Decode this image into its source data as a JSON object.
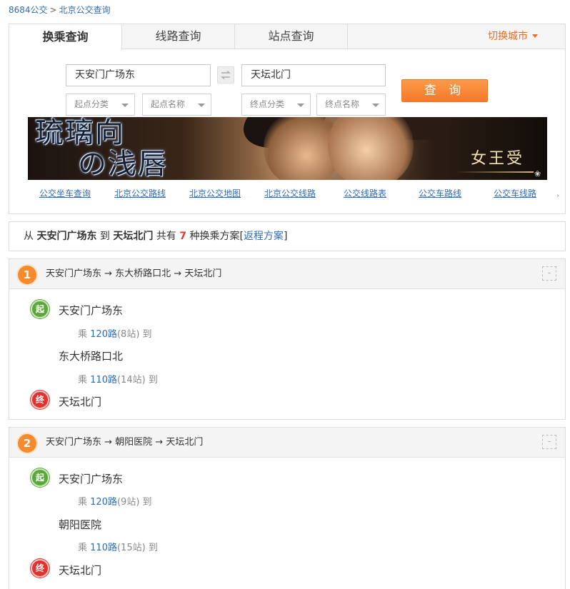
{
  "breadcrumb": {
    "home": "8684公交",
    "sep": ">",
    "current": "北京公交查询"
  },
  "tabs": [
    {
      "label": "换乘查询"
    },
    {
      "label": "线路查询"
    },
    {
      "label": "站点查询"
    }
  ],
  "switch_city": "切换城市",
  "search": {
    "from_value": "天安门广场东",
    "to_value": "天坛北门",
    "start_category": "起点分类",
    "start_name": "起点名称",
    "end_category": "终点分类",
    "end_name": "终点名称",
    "submit_label": "查 询"
  },
  "banner": {
    "title_line1": "琉璃向",
    "title_line2": "の浅唇",
    "subtitle": "女王受"
  },
  "quick_links": [
    "公交坐车查询",
    "北京公交路线",
    "北京公交地图",
    "北京公交线路",
    "公交线路表",
    "公交车路线",
    "公交车线路"
  ],
  "summary": {
    "from_prefix": "从",
    "from": "天安门广场东",
    "to_prefix": "到",
    "to": "天坛北门",
    "total_prefix": "共有",
    "count": "7",
    "total_suffix": "种换乘方案",
    "return_open": "[",
    "return_link": "返程方案",
    "return_close": "]"
  },
  "plans": [
    {
      "num": "1",
      "route": "天安门广场东 → 东大桥路口北 → 天坛北门",
      "toggle": "-",
      "start_badge": "起",
      "start": "天安门广场东",
      "leg1": {
        "ride": "乘",
        "line": "120路",
        "stops": "(8站)",
        "arrive": "到"
      },
      "transfer": "东大桥路口北",
      "leg2": {
        "ride": "乘",
        "line": "110路",
        "stops": "(14站)",
        "arrive": "到"
      },
      "end_badge": "终",
      "end": "天坛北门"
    },
    {
      "num": "2",
      "route": "天安门广场东 → 朝阳医院 → 天坛北门",
      "toggle": "-",
      "start_badge": "起",
      "start": "天安门广场东",
      "leg1": {
        "ride": "乘",
        "line": "120路",
        "stops": "(9站)",
        "arrive": "到"
      },
      "transfer": "朝阳医院",
      "leg2": {
        "ride": "乘",
        "line": "110路",
        "stops": "(15站)",
        "arrive": "到"
      },
      "end_badge": "终",
      "end": "天坛北门"
    }
  ],
  "colors": {
    "accent": "#f58b2e",
    "link": "#2f6cb5",
    "start": "#5aa83a",
    "end": "#e0322e"
  }
}
